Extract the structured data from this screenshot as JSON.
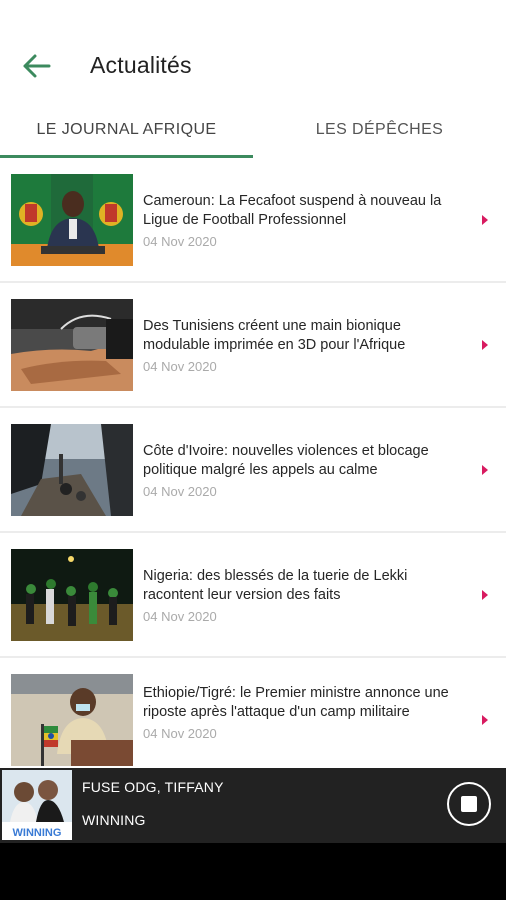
{
  "header": {
    "title": "Actualités",
    "back_icon": "arrow-left-icon",
    "accent": "#3c8a5e"
  },
  "tabs": [
    {
      "label": "LE JOURNAL AFRIQUE",
      "selected": true
    },
    {
      "label": "LES DÉPÊCHES",
      "selected": false
    }
  ],
  "articles": [
    {
      "headline": "Cameroun: La Fecafoot suspend à nouveau la Ligue de Football Professionnel",
      "date": "04 Nov 2020",
      "thumb": "cameroun-press-photo"
    },
    {
      "headline": "Des Tunisiens créent une main bionique modulable imprimée en 3D pour l'Afrique",
      "date": "04 Nov 2020",
      "thumb": "bionic-hand-photo"
    },
    {
      "headline": "Côte d'Ivoire: nouvelles violences et blocage politique malgré les appels au calme",
      "date": "04 Nov 2020",
      "thumb": "street-violence-photo"
    },
    {
      "headline": "Nigeria: des blessés de la tuerie de Lekki racontent leur version des faits",
      "date": "04 Nov 2020",
      "thumb": "lekki-protest-photo"
    },
    {
      "headline": "Ethiopie/Tigré: le Premier ministre annonce une riposte après l'attaque d'un camp militaire",
      "date": "04 Nov 2020",
      "thumb": "prime-minister-photo"
    }
  ],
  "player": {
    "title": "FUSE ODG, TIFFANY",
    "subtitle": "WINNING",
    "cover_text": "WINNING",
    "stop_icon": "stop-icon"
  },
  "colors": {
    "chevron": "#d81b60",
    "tab_indicator": "#3c8a5e",
    "player_bg": "#222222"
  }
}
